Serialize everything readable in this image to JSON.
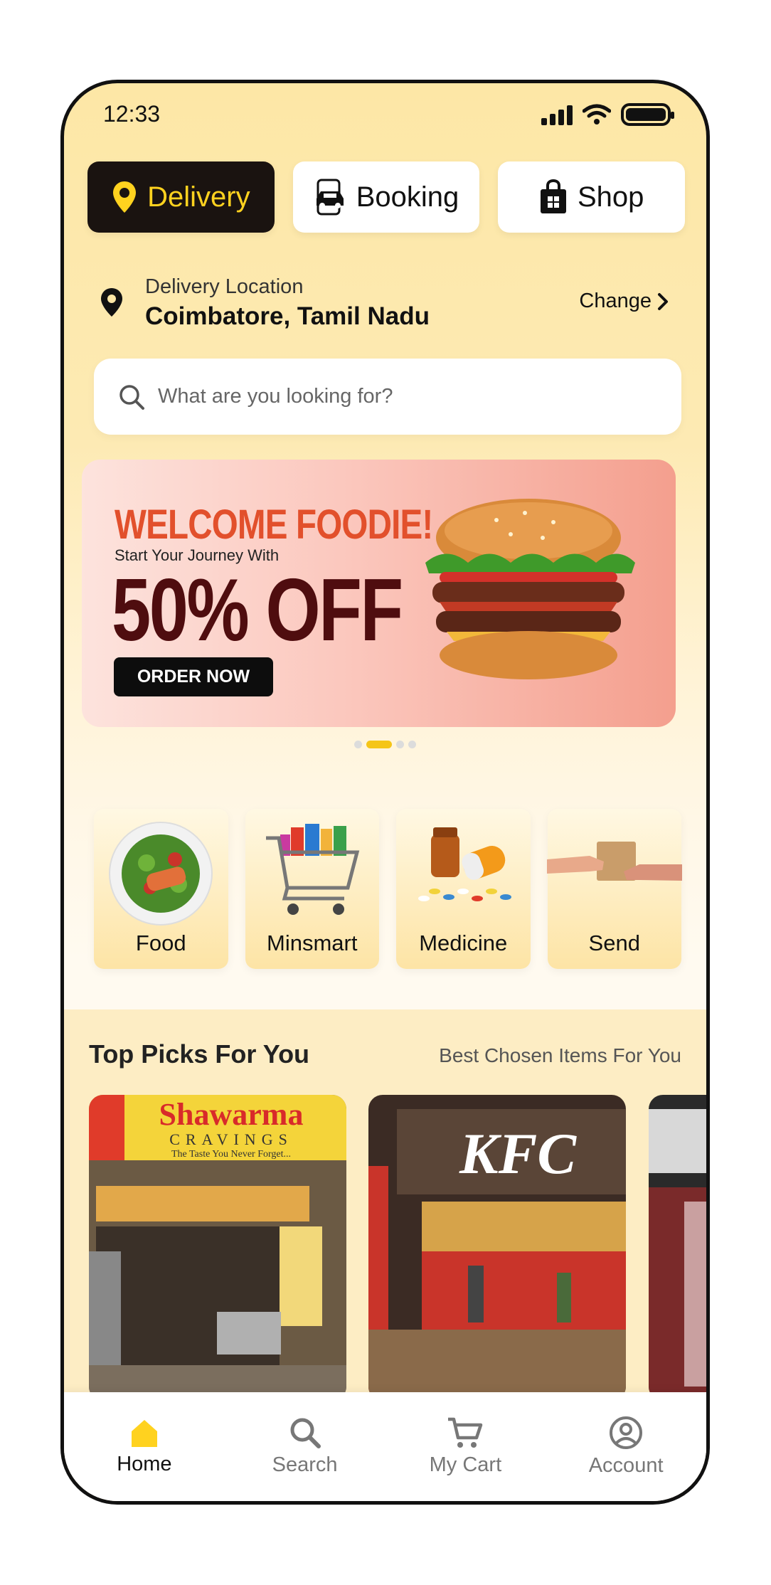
{
  "status_bar": {
    "time": "12:33"
  },
  "tabs": [
    {
      "label": "Delivery",
      "icon": "location-pin-icon",
      "active": true
    },
    {
      "label": "Booking",
      "icon": "car-booking-icon",
      "active": false
    },
    {
      "label": "Shop",
      "icon": "shopping-bag-icon",
      "active": false
    }
  ],
  "location": {
    "label": "Delivery Location",
    "city": "Coimbatore, Tamil Nadu",
    "change_label": "Change"
  },
  "search": {
    "placeholder": "What are you looking for?"
  },
  "banner": {
    "headline": "WELCOME FOODIE!",
    "subtext": "Start Your Journey With",
    "offer": "50% OFF",
    "button_label": "ORDER NOW",
    "active_slide": 2,
    "slide_count": 4
  },
  "categories": [
    {
      "label": "Food"
    },
    {
      "label": "Minsmart"
    },
    {
      "label": "Medicine"
    },
    {
      "label": "Send"
    }
  ],
  "top_picks": {
    "title": "Top Picks For You",
    "subtitle": "Best Chosen Items For You",
    "cards": [
      {
        "sign_line1": "Shawarma",
        "sign_line2": "CRAVINGS",
        "sign_line3": "The Taste You Never Forget..."
      },
      {
        "sign_line1": "KFC"
      }
    ]
  },
  "bottom_nav": [
    {
      "label": "Home",
      "icon": "home-icon",
      "active": true
    },
    {
      "label": "Search",
      "icon": "search-icon",
      "active": false
    },
    {
      "label": "My Cart",
      "icon": "cart-icon",
      "active": false
    },
    {
      "label": "Account",
      "icon": "account-icon",
      "active": false
    }
  ],
  "colors": {
    "accent": "#ffd21f",
    "dark": "#1a1310",
    "banner_headline": "#e2502c",
    "banner_offer": "#4f0d0f"
  }
}
